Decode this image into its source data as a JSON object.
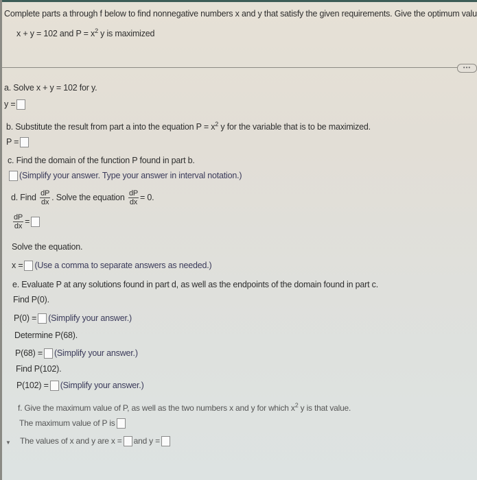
{
  "problem": {
    "intro": "Complete parts a through f below to find nonnegative numbers x and y that satisfy the given requirements. Give the optimum value of P.",
    "condition_prefix": "x + y = 102 and P = x",
    "condition_exp": "2",
    "condition_suffix": "y is maximized"
  },
  "more_button": {
    "label": "•••",
    "icon": "ellipsis-icon"
  },
  "part_a": {
    "prompt": "a. Solve x + y = 102 for y.",
    "answer_label": "y =",
    "answer_value": ""
  },
  "part_b": {
    "prompt_prefix": "b. Substitute the result from part a into the equation P = x",
    "prompt_exp": "2",
    "prompt_suffix": "y for the variable that is to be maximized.",
    "answer_label": "P =",
    "answer_value": ""
  },
  "part_c": {
    "prompt": "c. Find the domain of the function P found in part b.",
    "answer_value": "",
    "hint": "(Simplify your answer. Type your answer in interval notation.)"
  },
  "part_d": {
    "prompt_find": "d. Find",
    "frac_num": "dP",
    "frac_den": "dx",
    "prompt_solve": ". Solve the equation",
    "equals_zero": "= 0.",
    "answer_equals": "=",
    "answer_value": "",
    "solve_label": "Solve the equation.",
    "x_label": "x =",
    "x_value": "",
    "x_hint": "(Use a comma to separate answers as needed.)"
  },
  "part_e": {
    "prompt": "e. Evaluate P at any solutions found in part d, as well as the endpoints of the domain found in part c.",
    "items": [
      {
        "instruction": "Find P(0).",
        "label": "P(0) =",
        "value": "",
        "hint": "(Simplify your answer.)"
      },
      {
        "instruction": "Determine P(68).",
        "label": "P(68) =",
        "value": "",
        "hint": "(Simplify your answer.)"
      },
      {
        "instruction": "Find P(102).",
        "label": "P(102) =",
        "value": "",
        "hint": "(Simplify your answer.)"
      }
    ]
  },
  "part_f": {
    "prompt_prefix": "f. Give the maximum value of P, as well as the two numbers x and y for which x",
    "prompt_exp": "2",
    "prompt_suffix": "y is that value.",
    "max_label": "The maximum value of P is",
    "max_value": "",
    "values_label": "The values of x and y are x =",
    "x_value": "",
    "and_label": "and y =",
    "y_value": ""
  }
}
